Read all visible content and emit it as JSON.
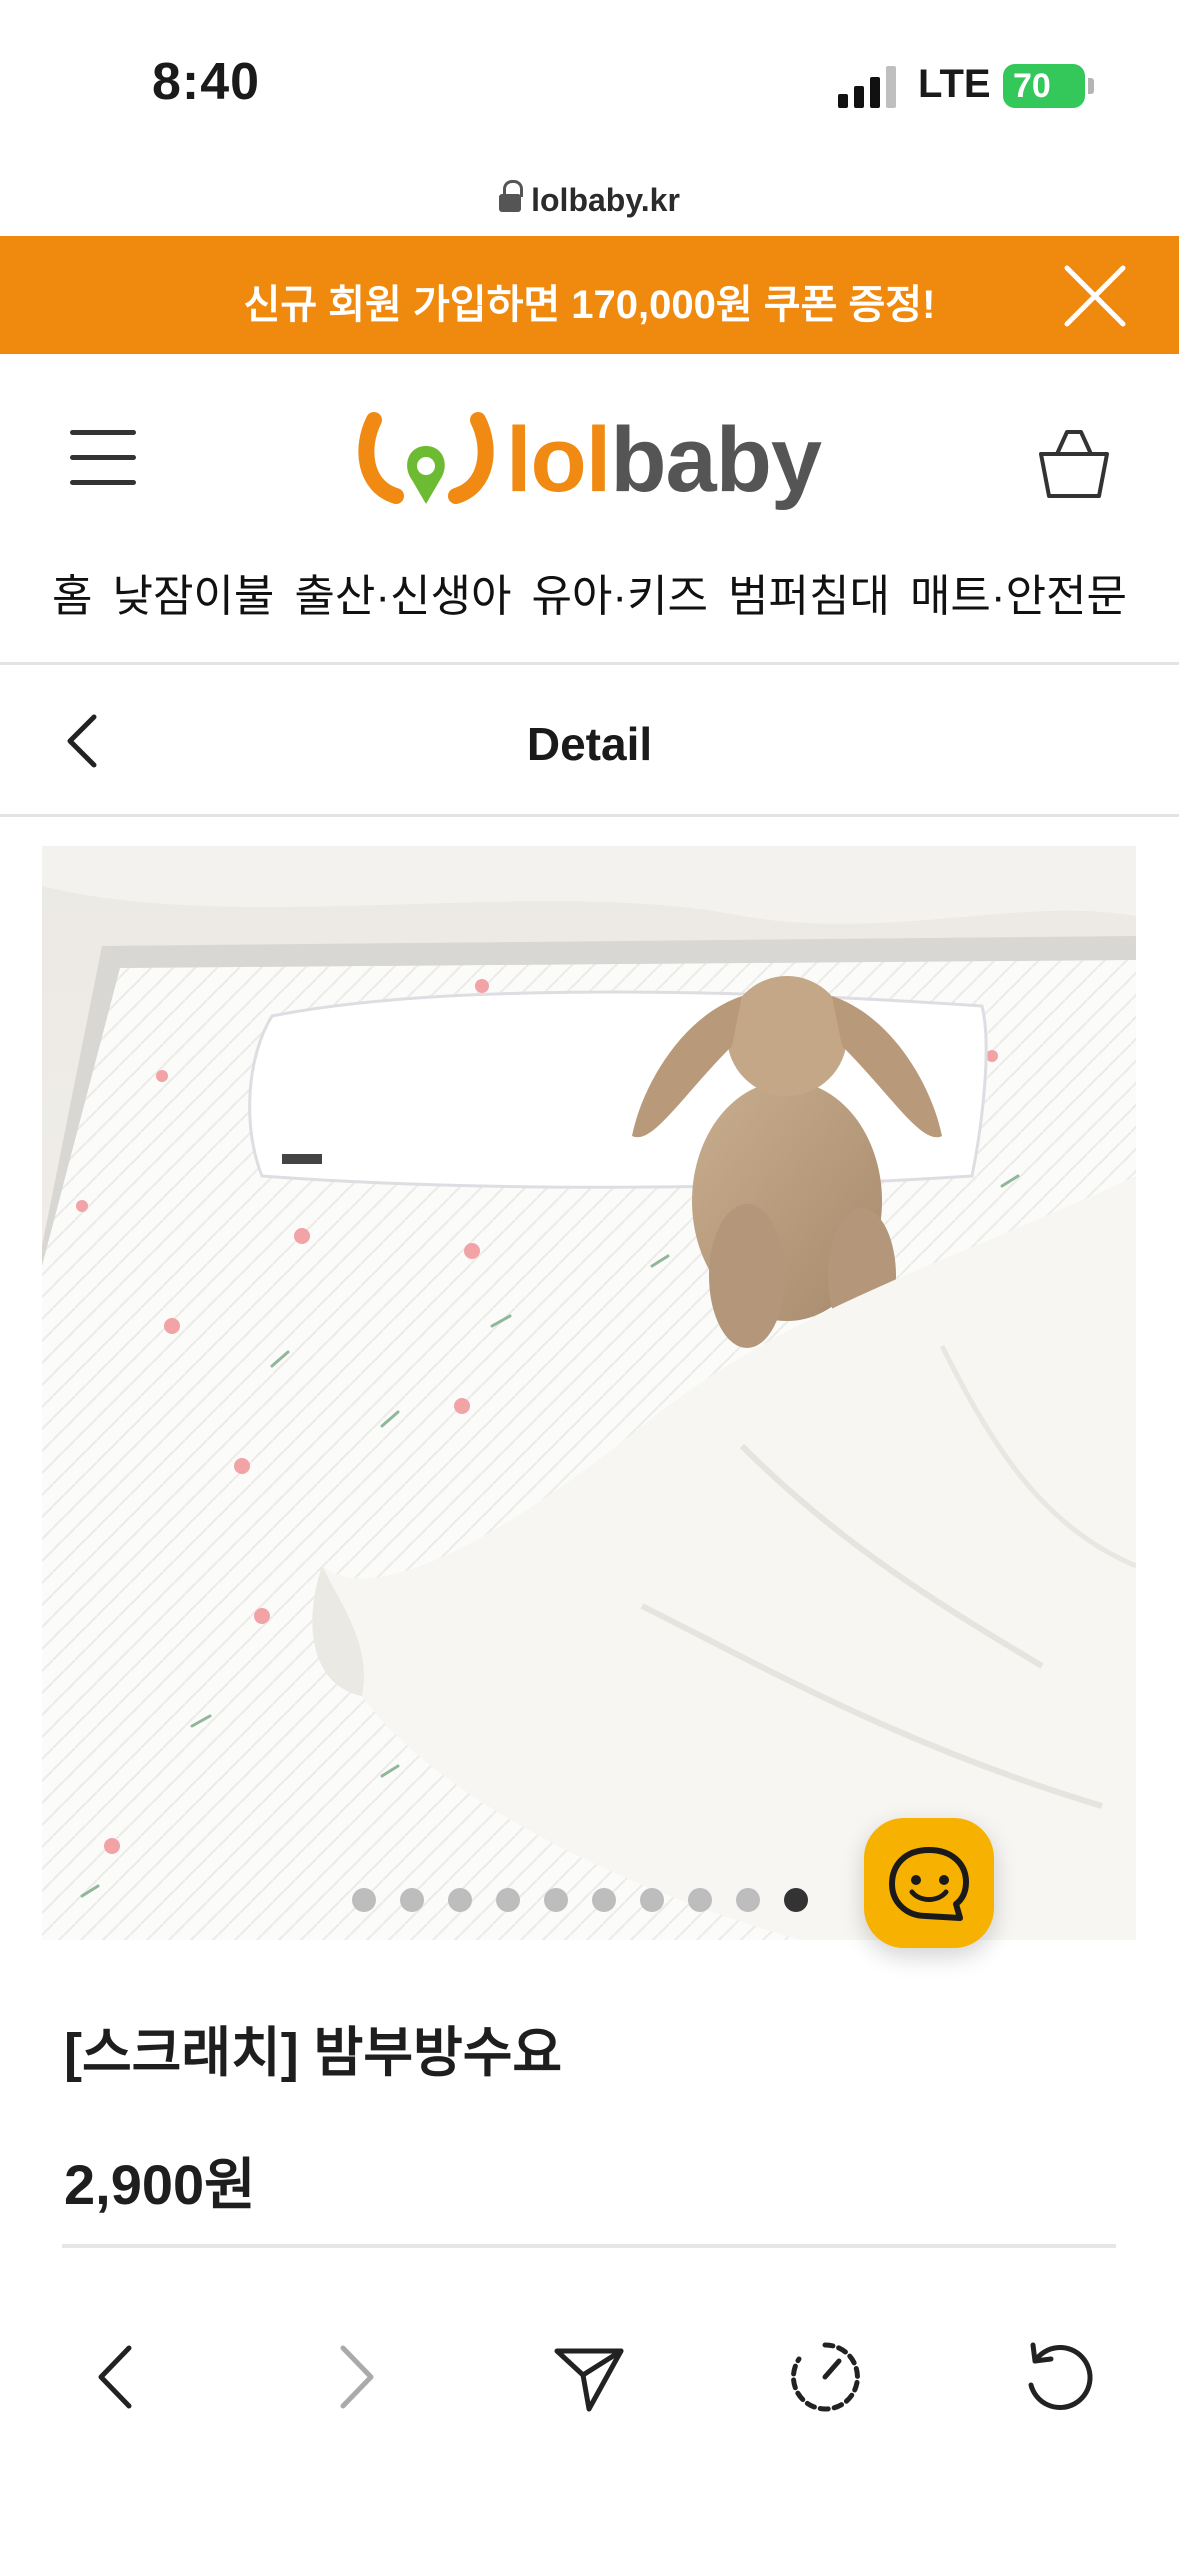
{
  "status_bar": {
    "time": "8:40",
    "network": "LTE",
    "battery": "70"
  },
  "browser": {
    "domain": "lolbaby.kr"
  },
  "promo_banner": {
    "text": "신규 회원 가입하면 170,000원 쿠폰 증정!"
  },
  "header": {
    "logo_text_a": "lol",
    "logo_text_b": "baby"
  },
  "category_nav": [
    "홈",
    "낮잠이불",
    "출산·신생아",
    "유아·키즈",
    "범퍼침대",
    "매트·안전문"
  ],
  "detail_bar": {
    "title": "Detail"
  },
  "product": {
    "name": "[스크래치] 밤부방수요",
    "price": "2,900원",
    "image_count": 10,
    "active_image_index": 10
  },
  "colors": {
    "accent": "#ef8a0f",
    "chat": "#f7b100"
  },
  "icons": [
    "menu-icon",
    "cart-icon",
    "close-icon",
    "back-chevron-icon",
    "chat-icon",
    "back-icon",
    "forward-icon",
    "share-icon",
    "history-icon",
    "reload-icon"
  ]
}
